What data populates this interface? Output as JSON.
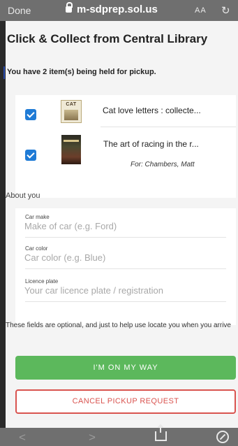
{
  "browser": {
    "done_label": "Done",
    "url": "m-sdprep.sol.us",
    "text_size_label": "AA",
    "reload_icon": "↻"
  },
  "page": {
    "title": "Click & Collect from Central Library",
    "subtitle": "You have 2 item(s) being held for pickup."
  },
  "items": [
    {
      "title": "Cat love letters : collecte...",
      "cover_text": "CAT",
      "checked": true
    },
    {
      "title": "The art of racing in the r...",
      "for": "For: Chambers, Matt",
      "checked": true
    }
  ],
  "form": {
    "section_label": "About you",
    "car_make": {
      "label": "Car make",
      "placeholder": "Make of car (e.g. Ford)",
      "value": ""
    },
    "car_color": {
      "label": "Car color",
      "placeholder": "Car color (e.g. Blue)",
      "value": ""
    },
    "licence_plate": {
      "label": "Licence plate",
      "placeholder": "Your car licence plate / registration",
      "value": ""
    },
    "note": "These fields are optional, and just to help use locate you when you arrive"
  },
  "actions": {
    "on_my_way": "I'M ON MY WAY",
    "cancel": "CANCEL PICKUP REQUEST"
  },
  "toolbar": {
    "back": "<",
    "forward": ">"
  },
  "colors": {
    "primary_green": "#5cb85c",
    "danger_red": "#d9534f",
    "checkbox_blue": "#1f7bd6"
  }
}
